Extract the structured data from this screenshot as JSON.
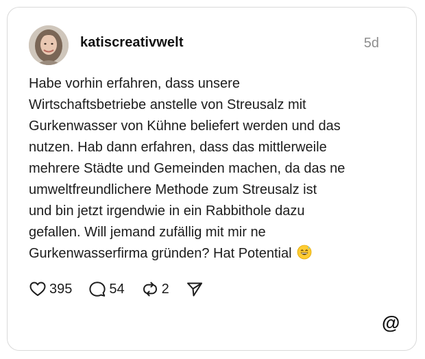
{
  "post": {
    "username": "katiscreativwelt",
    "timestamp": "5d",
    "text_lines": [
      "Habe vorhin erfahren, dass unsere",
      "Wirtschaftsbetriebe anstelle von Streusalz mit",
      "Gurkenwasser von Kühne beliefert werden und das",
      "nutzen. Hab dann erfahren, dass das mittlerweile",
      "mehrere Städte und Gemeinden machen, da das ne",
      "umweltfreundlichere Methode zum Streusalz ist",
      "und bin jetzt irgendwie in ein Rabbithole dazu",
      "gefallen. Will jemand zufällig mit mir ne",
      "Gurkenwasserfirma gründen? Hat Potential"
    ],
    "emoji": "grinning-face-with-sweat"
  },
  "actions": {
    "likes": "395",
    "comments": "54",
    "reposts": "2",
    "like_icon": "heart-icon",
    "comment_icon": "speech-bubble-icon",
    "repost_icon": "repost-icon",
    "share_icon": "send-icon"
  },
  "brand": {
    "logo_icon": "threads-logo-icon",
    "logo_glyph": "@"
  },
  "colors": {
    "text": "#1c1c1c",
    "muted": "#8e8e8e",
    "border": "#d9d9d9",
    "background": "#ffffff"
  }
}
